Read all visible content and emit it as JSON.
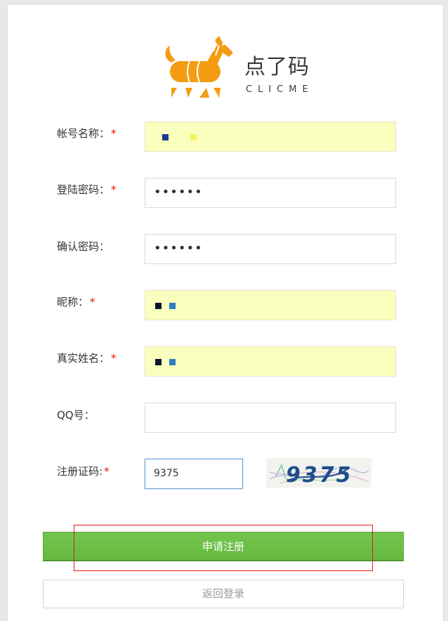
{
  "logo": {
    "title": "点了码",
    "subtitle": "CLICME",
    "brand_color": "#f39c12"
  },
  "form": {
    "account_name": {
      "label": "帐号名称：",
      "required": "*",
      "value": ""
    },
    "password": {
      "label": "登陆密码：",
      "required": "*",
      "value": "••••••"
    },
    "confirm_password": {
      "label": "确认密码：",
      "value": "••••••"
    },
    "nickname": {
      "label": "昵称：",
      "required": "*",
      "value": ""
    },
    "real_name": {
      "label": "真实姓名：",
      "required": "*",
      "value": ""
    },
    "qq": {
      "label": "QQ号：",
      "value": ""
    },
    "captcha": {
      "label": "注册证码:",
      "required": "*",
      "value": "9375",
      "image_text": "9375"
    }
  },
  "buttons": {
    "submit": "申请注册",
    "back_to_login": "返回登录"
  },
  "colors": {
    "primary_button": "#6dc147",
    "required_marker": "#e2140c",
    "autofill_bg": "#faffbd",
    "annotation": "#e0191b"
  }
}
